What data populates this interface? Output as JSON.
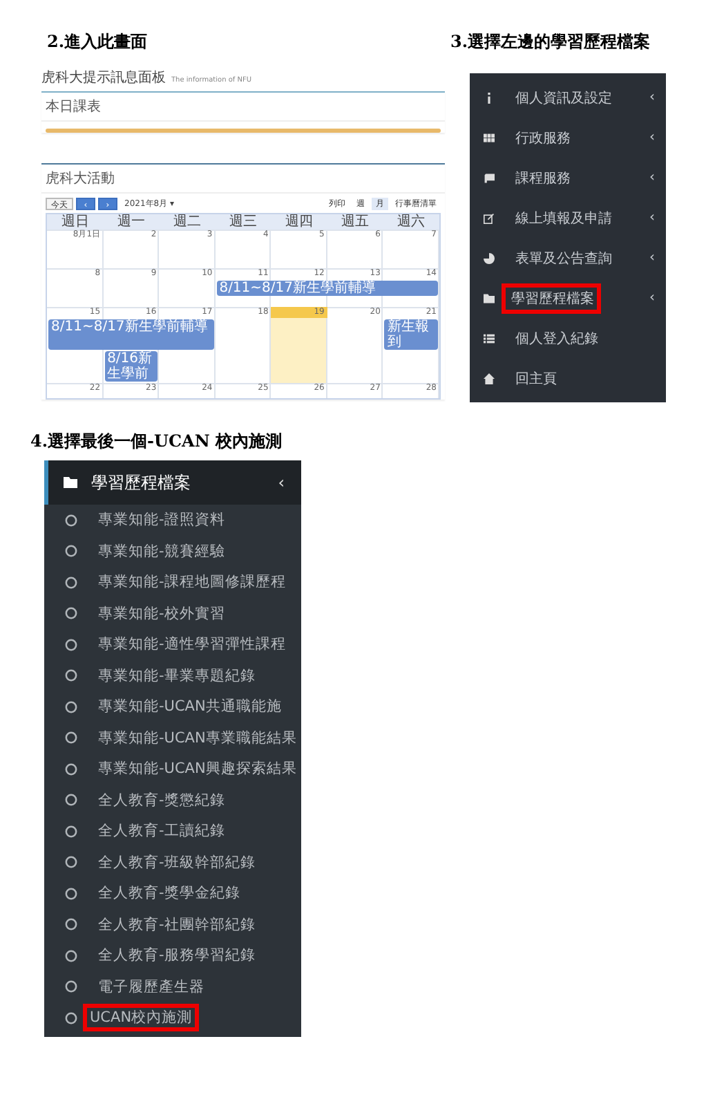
{
  "dashboard": {
    "step_title": "2.進入此畫面",
    "panel_title": "虎科大提示訊息面板",
    "panel_subtitle": "The information of NFU",
    "schedule_title": "本日課表",
    "activity_title": "虎科大活動",
    "calendar": {
      "today_button": "今天",
      "prev": "‹",
      "next": "›",
      "month_label": "2021年8月",
      "month_caret": "▾",
      "print": "列印",
      "view_buttons": [
        {
          "label": "週",
          "selected": false
        },
        {
          "label": "月",
          "selected": true
        },
        {
          "label": "行事曆清單",
          "selected": false
        }
      ],
      "weekdays": [
        "週日",
        "週一",
        "週二",
        "週三",
        "週四",
        "週五",
        "週六"
      ],
      "weeks": [
        {
          "days": [
            {
              "label": "8月1日",
              "today": false
            },
            {
              "label": "2",
              "today": false
            },
            {
              "label": "3",
              "today": false
            },
            {
              "label": "4",
              "today": false
            },
            {
              "label": "5",
              "today": false
            },
            {
              "label": "6",
              "today": false
            },
            {
              "label": "7",
              "today": false
            }
          ]
        },
        {
          "days": [
            {
              "label": "8",
              "today": false
            },
            {
              "label": "9",
              "today": false
            },
            {
              "label": "10",
              "today": false
            },
            {
              "label": "11",
              "today": false,
              "events": [
                {
                  "text": "8/11~8/17新生學前輔導"
                }
              ]
            },
            {
              "label": "12",
              "today": false,
              "events": [
                {
                  "continued": true
                }
              ]
            },
            {
              "label": "13",
              "today": false,
              "events": [
                {
                  "continued": true
                }
              ]
            },
            {
              "label": "14",
              "today": false,
              "events": [
                {
                  "continued": true
                }
              ]
            }
          ]
        },
        {
          "days": [
            {
              "label": "15",
              "today": false,
              "events": [
                {
                  "text": "8/11~8/17新生學前輔導"
                }
              ]
            },
            {
              "label": "16",
              "today": false,
              "events": [
                {
                  "continued": true
                },
                {
                  "text": "8/16新生學前"
                }
              ]
            },
            {
              "label": "17",
              "today": false,
              "events": [
                {
                  "continued": true
                }
              ]
            },
            {
              "label": "18",
              "today": false
            },
            {
              "label": "19",
              "today": true
            },
            {
              "label": "20",
              "today": false
            },
            {
              "label": "21",
              "today": false,
              "events": [
                {
                  "text": "新生報到"
                }
              ]
            }
          ]
        },
        {
          "days": [
            {
              "label": "22",
              "today": false
            },
            {
              "label": "23",
              "today": false
            },
            {
              "label": "24",
              "today": false
            },
            {
              "label": "25",
              "today": false
            },
            {
              "label": "26",
              "today": false
            },
            {
              "label": "27",
              "today": false
            },
            {
              "label": "28",
              "today": false
            }
          ]
        }
      ]
    }
  },
  "menu": {
    "step_title": "3.選擇左邊的學習歷程檔案",
    "items": [
      {
        "label": "個人資訊及設定",
        "arrow": "‹",
        "selected": false
      },
      {
        "label": "行政服務",
        "arrow": "‹",
        "selected": false
      },
      {
        "label": "課程服務",
        "arrow": "‹",
        "selected": false
      },
      {
        "label": "線上填報及申請",
        "arrow": "‹",
        "selected": false
      },
      {
        "label": "表單及公告查詢",
        "arrow": "‹",
        "selected": false
      },
      {
        "label": "學習歷程檔案",
        "arrow": "‹",
        "selected": true
      },
      {
        "label": "個人登入紀錄",
        "selected": false
      },
      {
        "label": "回主頁",
        "selected": false
      }
    ]
  },
  "submenu": {
    "step_title": "4.選擇最後一個-UCAN 校內施測",
    "header": "學習歷程檔案",
    "header_arrow": "‹",
    "items": [
      {
        "label": "專業知能-證照資料",
        "selected": false
      },
      {
        "label": "專業知能-競賽經驗",
        "selected": false
      },
      {
        "label": "專業知能-課程地圖修課歷程",
        "selected": false
      },
      {
        "label": "專業知能-校外實習",
        "selected": false
      },
      {
        "label": "專業知能-適性學習彈性課程",
        "selected": false
      },
      {
        "label": "專業知能-畢業專題紀錄",
        "selected": false
      },
      {
        "label": "專業知能-UCAN共通職能施",
        "selected": false
      },
      {
        "label": "專業知能-UCAN專業職能結果",
        "selected": false
      },
      {
        "label": "專業知能-UCAN興趣探索結果",
        "selected": false
      },
      {
        "label": "全人教育-獎懲紀錄",
        "selected": false
      },
      {
        "label": "全人教育-工讀紀錄",
        "selected": false
      },
      {
        "label": "全人教育-班級幹部紀錄",
        "selected": false
      },
      {
        "label": "全人教育-獎學金紀錄",
        "selected": false
      },
      {
        "label": "全人教育-社團幹部紀錄",
        "selected": false
      },
      {
        "label": "全人教育-服務學習紀錄",
        "selected": false
      },
      {
        "label": "電子履歷產生器",
        "selected": false
      },
      {
        "label": "UCAN校內施測",
        "selected": true
      }
    ]
  }
}
